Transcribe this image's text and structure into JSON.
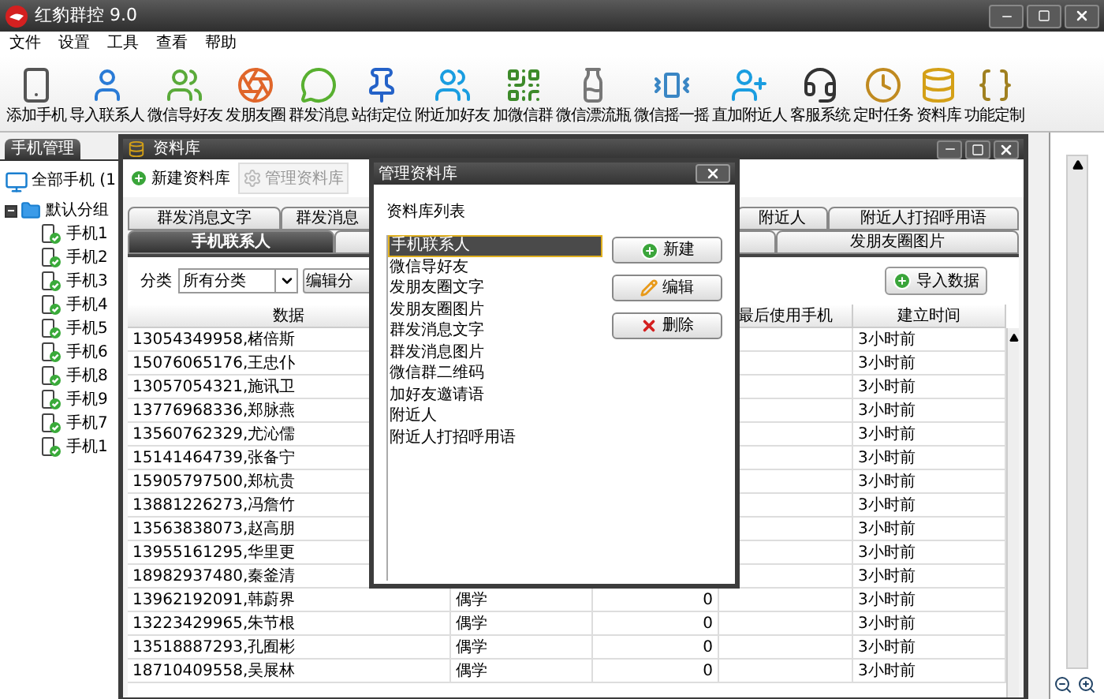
{
  "window": {
    "title": "红豹群控 9.0"
  },
  "menu": [
    "文件",
    "设置",
    "工具",
    "查看",
    "帮助"
  ],
  "toolbar": [
    "添加手机",
    "导入联系人",
    "微信导好友",
    "发朋友圈",
    "群发消息",
    "站街定位",
    "附近加好友",
    "加微信群",
    "微信漂流瓶",
    "微信摇一摇",
    "直加附近人",
    "客服系统",
    "定时任务",
    "资料库",
    "功能定制"
  ],
  "left_panel": {
    "tab": "手机管理",
    "tree": [
      {
        "label": "全部手机 (1",
        "children": [
          {
            "label": "默认分组",
            "expanded": true,
            "children": [
              {
                "label": "手机1"
              },
              {
                "label": "手机2"
              },
              {
                "label": "手机3"
              },
              {
                "label": "手机4"
              },
              {
                "label": "手机5"
              },
              {
                "label": "手机6"
              },
              {
                "label": "手机8"
              },
              {
                "label": "手机9"
              },
              {
                "label": "手机7"
              },
              {
                "label": "手机1"
              }
            ]
          }
        ]
      }
    ]
  },
  "library_window": {
    "title": "资料库",
    "toolbar": [
      {
        "label": "新建资料库",
        "disabled": false
      },
      {
        "label": "管理资料库",
        "disabled": true
      }
    ],
    "tabs_row_1": [
      {
        "label": "群发消息文字",
        "selected": false
      },
      {
        "label": "群发消息",
        "selected": false
      },
      {
        "label": "附近人",
        "selected": false
      },
      {
        "label": "附近人打招呼用语",
        "selected": false
      }
    ],
    "tabs_row_2": [
      {
        "label": "手机联系人",
        "selected": true
      },
      {
        "label": "发朋友圈图片",
        "selected": false
      }
    ],
    "filter": {
      "label": "分类",
      "value": "所有分类",
      "edit_button": "编辑分"
    },
    "import_button": "导入数据",
    "columns": [
      "数据",
      "最后使用手机",
      "建立时间"
    ],
    "rows": [
      {
        "data": "13054349958,楮倍斯",
        "created": "3小时前"
      },
      {
        "data": "15076065176,王忠仆",
        "created": "3小时前"
      },
      {
        "data": "13057054321,施讯卫",
        "created": "3小时前"
      },
      {
        "data": "13776968336,郑脉燕",
        "created": "3小时前"
      },
      {
        "data": "13560762329,尤沁儒",
        "created": "3小时前"
      },
      {
        "data": "15141464739,张备宁",
        "created": "3小时前"
      },
      {
        "data": "15905797500,郑杭贵",
        "created": "3小时前"
      },
      {
        "data": "13881226273,冯詹竹",
        "created": "3小时前"
      },
      {
        "data": "13563838073,赵高朋",
        "created": "3小时前"
      },
      {
        "data": "13955161295,华里更",
        "created": "3小时前"
      },
      {
        "data": "18982937480,秦釜清",
        "created": "3小时前"
      },
      {
        "data": "13962192091,韩蔚界",
        "column_2": "偶学",
        "column_3": "0",
        "created": "3小时前"
      },
      {
        "data": "13223429965,朱节根",
        "column_2": "偶学",
        "column_3": "0",
        "created": "3小时前"
      },
      {
        "data": "13518887293,孔囿彬",
        "column_2": "偶学",
        "column_3": "0",
        "created": "3小时前"
      },
      {
        "data": "18710409558,吴展林",
        "column_2": "偶学",
        "column_3": "0",
        "created": "3小时前"
      }
    ]
  },
  "dialog": {
    "title": "管理资料库",
    "list_label": "资料库列表",
    "items": [
      {
        "label": "手机联系人",
        "selected": true
      },
      {
        "label": "微信导好友",
        "selected": false
      },
      {
        "label": "发朋友圈文字",
        "selected": false
      },
      {
        "label": "发朋友圈图片",
        "selected": false
      },
      {
        "label": "群发消息文字",
        "selected": false
      },
      {
        "label": "群发消息图片",
        "selected": false
      },
      {
        "label": "微信群二维码",
        "selected": false
      },
      {
        "label": "加好友邀请语",
        "selected": false
      },
      {
        "label": "附近人",
        "selected": false
      },
      {
        "label": "附近人打招呼用语",
        "selected": false
      }
    ],
    "buttons": [
      {
        "kind": "new",
        "label": "新建"
      },
      {
        "kind": "edit",
        "label": "编辑"
      },
      {
        "kind": "delete",
        "label": "删除"
      }
    ]
  }
}
